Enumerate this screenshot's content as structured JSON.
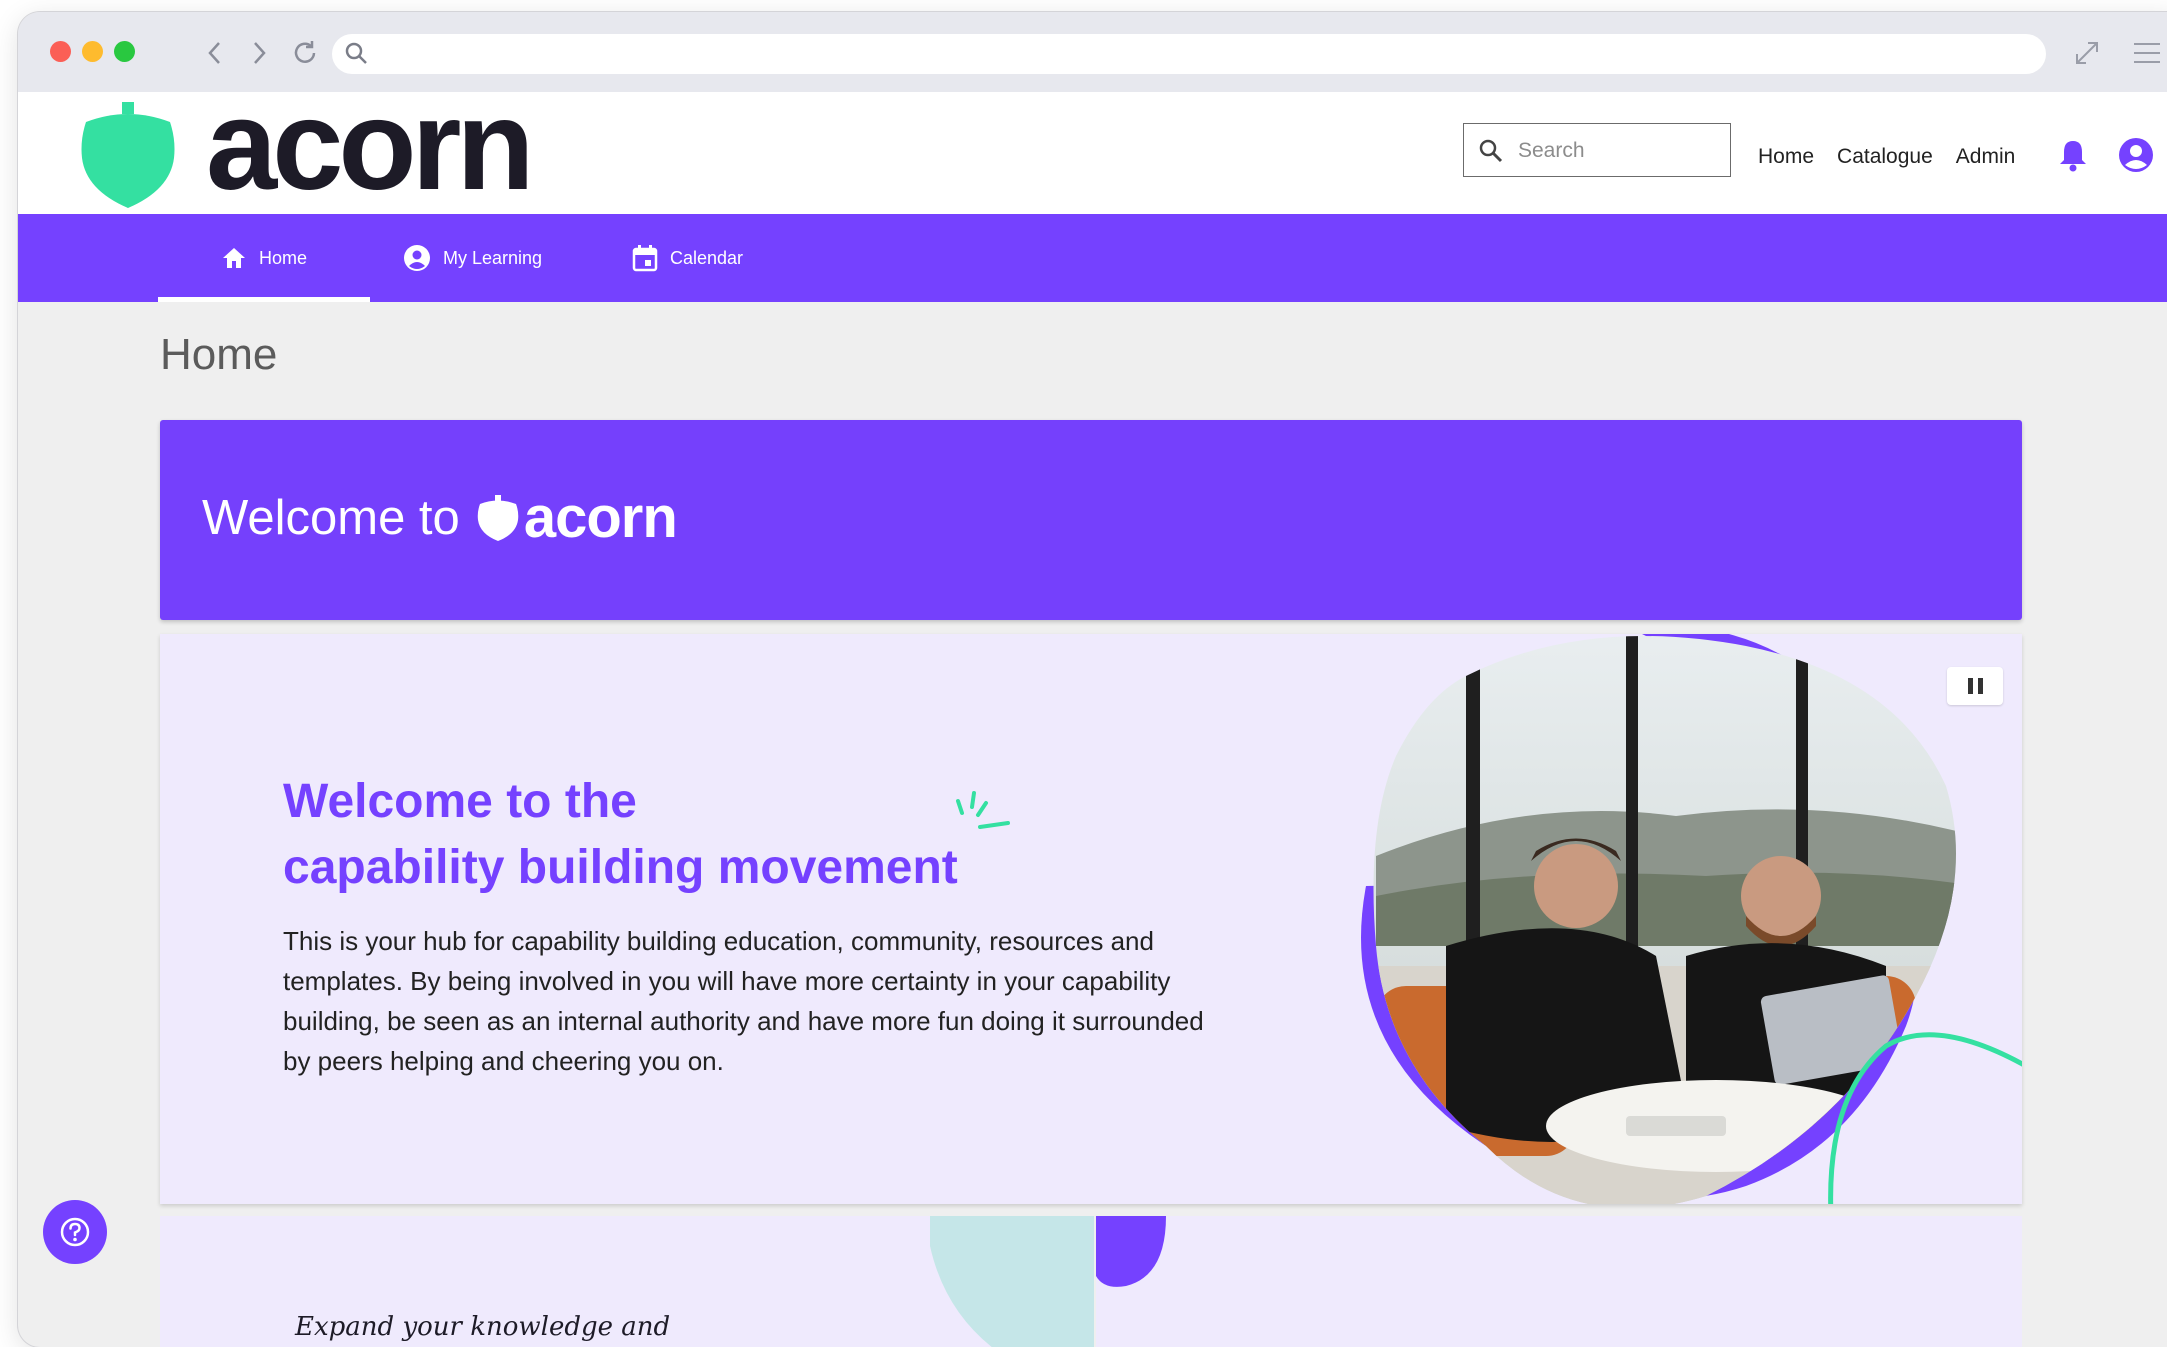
{
  "header": {
    "logo_text": "acorn",
    "search_placeholder": "Search",
    "links": [
      "Home",
      "Catalogue",
      "Admin"
    ]
  },
  "nav": {
    "items": [
      {
        "label": "Home",
        "icon": "home-icon",
        "active": true
      },
      {
        "label": "My Learning",
        "icon": "person-circle-icon",
        "active": false
      },
      {
        "label": "Calendar",
        "icon": "calendar-icon",
        "active": false
      }
    ]
  },
  "page": {
    "title": "Home",
    "banner_prefix": "Welcome to",
    "banner_logo_text": "acorn"
  },
  "hero": {
    "title_line1": "Welcome to the",
    "title_line2": "capability building movement",
    "body": "This is your hub for capability building education, community, resources and templates. By being involved in you will have more certainty in your capability building, be seen as an internal authority and have more fun doing it surrounded by peers helping and cheering you on."
  },
  "cards": {
    "left_text": "Expand your knowledge and"
  },
  "colors": {
    "brand_purple": "#7541ff",
    "acorn_green": "#34e0a1",
    "hero_bg": "#efeafd",
    "teal": "#c5e6e8"
  }
}
